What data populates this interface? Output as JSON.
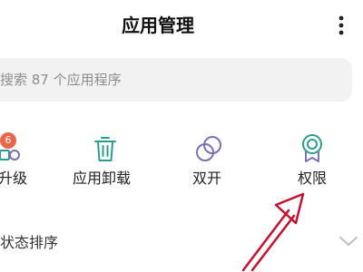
{
  "header": {
    "title": "应用管理",
    "more_icon": "more-vertical-icon"
  },
  "search": {
    "placeholder": "搜索 87 个应用程序",
    "icon": "search-icon"
  },
  "actions": [
    {
      "label": "升级",
      "icon": "upgrade-icon",
      "badge": "6"
    },
    {
      "label": "应用卸载",
      "icon": "trash-icon"
    },
    {
      "label": "双开",
      "icon": "dual-circles-icon"
    },
    {
      "label": "权限",
      "icon": "medal-icon"
    }
  ],
  "sort": {
    "label": "状态排序",
    "icon": "chevron-down-icon"
  },
  "colors": {
    "accent": "#2a9d8f",
    "icon_purple": "#7b6fb8",
    "badge": "#e8664a",
    "arrow": "#c8102e"
  }
}
